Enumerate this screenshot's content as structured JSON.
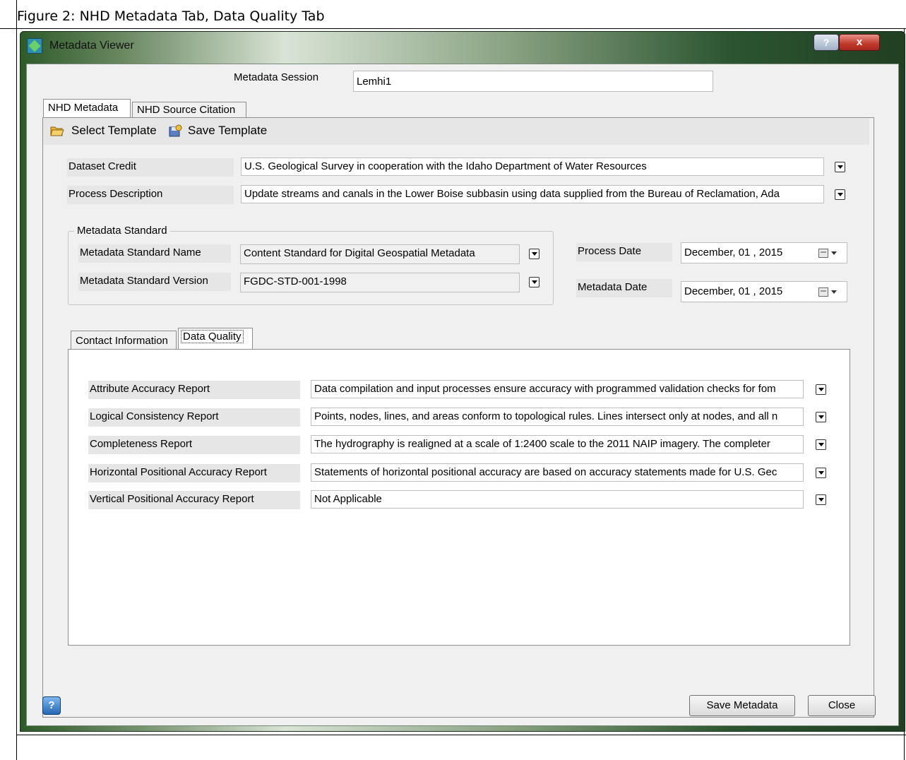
{
  "figure": {
    "caption": "Figure 2: NHD Metadata Tab, Data Quality Tab"
  },
  "window": {
    "title": "Metadata Viewer",
    "help_label": "?",
    "close_label": "x"
  },
  "session": {
    "label": "Metadata Session",
    "value": "Lemhi1"
  },
  "main_tabs": [
    {
      "label": "NHD Metadata",
      "active": true
    },
    {
      "label": "NHD Source Citation",
      "active": false
    }
  ],
  "toolbar": {
    "select_template": "Select Template",
    "save_template": "Save Template"
  },
  "dataset_credit": {
    "label": "Dataset Credit",
    "value": "U.S. Geological Survey in cooperation with the Idaho Department of Water Resources"
  },
  "process_description": {
    "label": "Process Description",
    "value": "Update streams and canals in the Lower Boise subbasin using data supplied from the Bureau of Reclamation, Ada"
  },
  "metadata_standard": {
    "group_label": "Metadata Standard",
    "name_label": "Metadata Standard Name",
    "name_value": "Content Standard for Digital Geospatial Metadata",
    "version_label": "Metadata Standard Version",
    "version_value": "FGDC-STD-001-1998"
  },
  "dates": {
    "process_label": "Process Date",
    "process_value": "December, 01 , 2015",
    "metadata_label": "Metadata Date",
    "metadata_value": "December, 01 , 2015"
  },
  "sub_tabs": [
    {
      "label": "Contact Information",
      "active": false
    },
    {
      "label": "Data Quality",
      "active": true
    }
  ],
  "data_quality": {
    "rows": [
      {
        "label": "Attribute Accuracy Report",
        "value": "Data compilation and input processes ensure accuracy with programmed validation checks for fom"
      },
      {
        "label": "Logical Consistency Report",
        "value": "Points, nodes, lines, and areas conform to topological rules. Lines intersect only at nodes, and all n"
      },
      {
        "label": "Completeness Report",
        "value": "The hydrography is realigned at a scale of 1:2400 scale to the 2011 NAIP imagery.  The completer"
      },
      {
        "label": "Horizontal Positional Accuracy Report",
        "value": "Statements of horizontal positional accuracy are based on accuracy statements made for U.S. Gec"
      },
      {
        "label": "Vertical Positional Accuracy Report",
        "value": "Not Applicable"
      }
    ]
  },
  "footer": {
    "save_metadata": "Save Metadata",
    "close": "Close",
    "help_icon_label": "?"
  }
}
